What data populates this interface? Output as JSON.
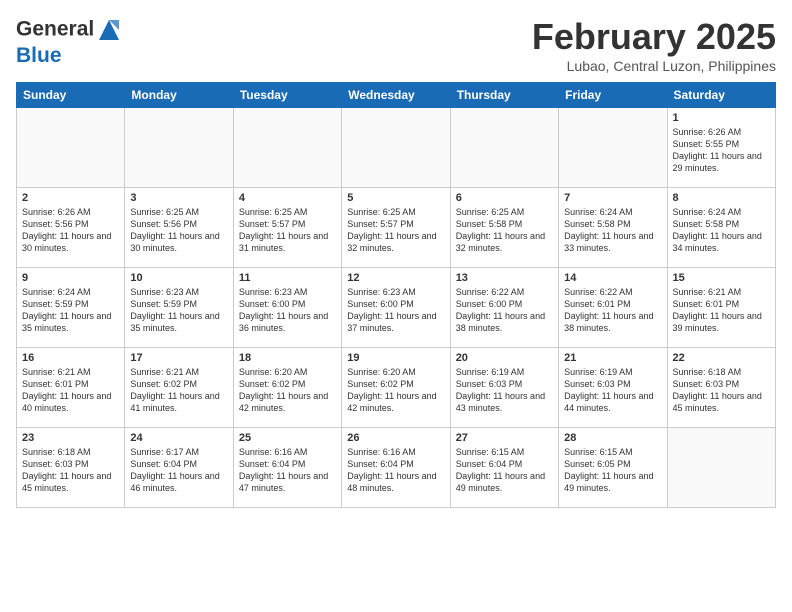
{
  "header": {
    "logo_general": "General",
    "logo_blue": "Blue",
    "month_title": "February 2025",
    "location": "Lubao, Central Luzon, Philippines"
  },
  "weekdays": [
    "Sunday",
    "Monday",
    "Tuesday",
    "Wednesday",
    "Thursday",
    "Friday",
    "Saturday"
  ],
  "weeks": [
    [
      {
        "day": "",
        "info": ""
      },
      {
        "day": "",
        "info": ""
      },
      {
        "day": "",
        "info": ""
      },
      {
        "day": "",
        "info": ""
      },
      {
        "day": "",
        "info": ""
      },
      {
        "day": "",
        "info": ""
      },
      {
        "day": "1",
        "info": "Sunrise: 6:26 AM\nSunset: 5:55 PM\nDaylight: 11 hours and 29 minutes."
      }
    ],
    [
      {
        "day": "2",
        "info": "Sunrise: 6:26 AM\nSunset: 5:56 PM\nDaylight: 11 hours and 30 minutes."
      },
      {
        "day": "3",
        "info": "Sunrise: 6:25 AM\nSunset: 5:56 PM\nDaylight: 11 hours and 30 minutes."
      },
      {
        "day": "4",
        "info": "Sunrise: 6:25 AM\nSunset: 5:57 PM\nDaylight: 11 hours and 31 minutes."
      },
      {
        "day": "5",
        "info": "Sunrise: 6:25 AM\nSunset: 5:57 PM\nDaylight: 11 hours and 32 minutes."
      },
      {
        "day": "6",
        "info": "Sunrise: 6:25 AM\nSunset: 5:58 PM\nDaylight: 11 hours and 32 minutes."
      },
      {
        "day": "7",
        "info": "Sunrise: 6:24 AM\nSunset: 5:58 PM\nDaylight: 11 hours and 33 minutes."
      },
      {
        "day": "8",
        "info": "Sunrise: 6:24 AM\nSunset: 5:58 PM\nDaylight: 11 hours and 34 minutes."
      }
    ],
    [
      {
        "day": "9",
        "info": "Sunrise: 6:24 AM\nSunset: 5:59 PM\nDaylight: 11 hours and 35 minutes."
      },
      {
        "day": "10",
        "info": "Sunrise: 6:23 AM\nSunset: 5:59 PM\nDaylight: 11 hours and 35 minutes."
      },
      {
        "day": "11",
        "info": "Sunrise: 6:23 AM\nSunset: 6:00 PM\nDaylight: 11 hours and 36 minutes."
      },
      {
        "day": "12",
        "info": "Sunrise: 6:23 AM\nSunset: 6:00 PM\nDaylight: 11 hours and 37 minutes."
      },
      {
        "day": "13",
        "info": "Sunrise: 6:22 AM\nSunset: 6:00 PM\nDaylight: 11 hours and 38 minutes."
      },
      {
        "day": "14",
        "info": "Sunrise: 6:22 AM\nSunset: 6:01 PM\nDaylight: 11 hours and 38 minutes."
      },
      {
        "day": "15",
        "info": "Sunrise: 6:21 AM\nSunset: 6:01 PM\nDaylight: 11 hours and 39 minutes."
      }
    ],
    [
      {
        "day": "16",
        "info": "Sunrise: 6:21 AM\nSunset: 6:01 PM\nDaylight: 11 hours and 40 minutes."
      },
      {
        "day": "17",
        "info": "Sunrise: 6:21 AM\nSunset: 6:02 PM\nDaylight: 11 hours and 41 minutes."
      },
      {
        "day": "18",
        "info": "Sunrise: 6:20 AM\nSunset: 6:02 PM\nDaylight: 11 hours and 42 minutes."
      },
      {
        "day": "19",
        "info": "Sunrise: 6:20 AM\nSunset: 6:02 PM\nDaylight: 11 hours and 42 minutes."
      },
      {
        "day": "20",
        "info": "Sunrise: 6:19 AM\nSunset: 6:03 PM\nDaylight: 11 hours and 43 minutes."
      },
      {
        "day": "21",
        "info": "Sunrise: 6:19 AM\nSunset: 6:03 PM\nDaylight: 11 hours and 44 minutes."
      },
      {
        "day": "22",
        "info": "Sunrise: 6:18 AM\nSunset: 6:03 PM\nDaylight: 11 hours and 45 minutes."
      }
    ],
    [
      {
        "day": "23",
        "info": "Sunrise: 6:18 AM\nSunset: 6:03 PM\nDaylight: 11 hours and 45 minutes."
      },
      {
        "day": "24",
        "info": "Sunrise: 6:17 AM\nSunset: 6:04 PM\nDaylight: 11 hours and 46 minutes."
      },
      {
        "day": "25",
        "info": "Sunrise: 6:16 AM\nSunset: 6:04 PM\nDaylight: 11 hours and 47 minutes."
      },
      {
        "day": "26",
        "info": "Sunrise: 6:16 AM\nSunset: 6:04 PM\nDaylight: 11 hours and 48 minutes."
      },
      {
        "day": "27",
        "info": "Sunrise: 6:15 AM\nSunset: 6:04 PM\nDaylight: 11 hours and 49 minutes."
      },
      {
        "day": "28",
        "info": "Sunrise: 6:15 AM\nSunset: 6:05 PM\nDaylight: 11 hours and 49 minutes."
      },
      {
        "day": "",
        "info": ""
      }
    ]
  ]
}
